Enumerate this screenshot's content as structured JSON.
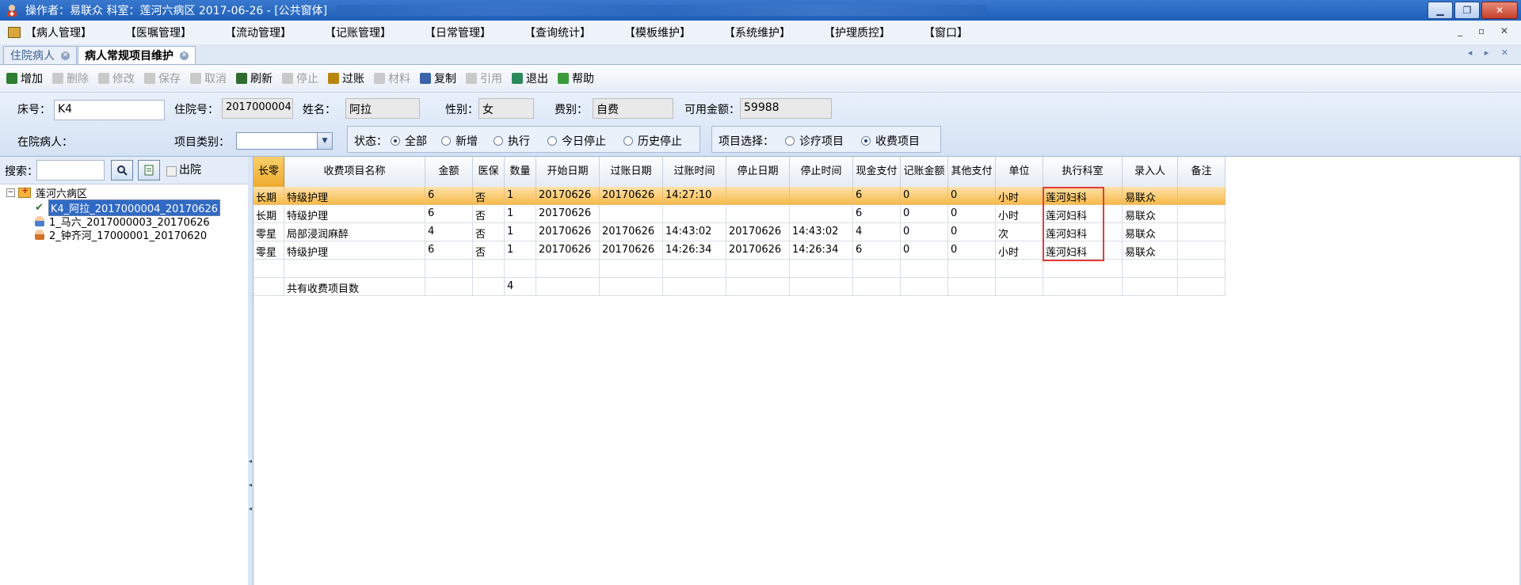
{
  "window": {
    "title": "操作者：易联众  科室：莲河六病区  2017-06-26 - [公共窗体]",
    "controls": {
      "minimize": "▁",
      "restore": "❐",
      "close": "✕"
    }
  },
  "menu": {
    "items": [
      "【病人管理】",
      "【医嘱管理】",
      "【流动管理】",
      "【记账管理】",
      "【日常管理】",
      "【查询统计】",
      "【模板维护】",
      "【系统维护】",
      "【护理质控】",
      "【窗口】"
    ],
    "right_controls": "_ ▫ ✕"
  },
  "tabs": [
    {
      "label": "住院病人",
      "active": false
    },
    {
      "label": "病人常规项目维护",
      "active": true
    }
  ],
  "tab_nav": "◂ ▸ ✕",
  "toolbar": {
    "buttons": [
      {
        "label": "增加",
        "enabled": true,
        "icon": "add-icon",
        "color": "#2e7d32"
      },
      {
        "label": "删除",
        "enabled": false,
        "icon": "delete-icon",
        "color": "#c9c9c9"
      },
      {
        "label": "修改",
        "enabled": false,
        "icon": "edit-icon",
        "color": "#c9c9c9"
      },
      {
        "label": "保存",
        "enabled": false,
        "icon": "save-icon",
        "color": "#c9c9c9"
      },
      {
        "label": "取消",
        "enabled": false,
        "icon": "cancel-icon",
        "color": "#c9c9c9"
      },
      {
        "label": "刷新",
        "enabled": true,
        "icon": "refresh-icon",
        "color": "#2f6b2f"
      },
      {
        "label": "停止",
        "enabled": false,
        "icon": "stop-icon",
        "color": "#c9c9c9"
      },
      {
        "label": "过账",
        "enabled": true,
        "icon": "post-icon",
        "color": "#b8860b"
      },
      {
        "label": "材料",
        "enabled": false,
        "icon": "material-icon",
        "color": "#c9c9c9"
      },
      {
        "label": "复制",
        "enabled": true,
        "icon": "copy-icon",
        "color": "#3b63a8"
      },
      {
        "label": "引用",
        "enabled": false,
        "icon": "reference-icon",
        "color": "#c9c9c9"
      },
      {
        "label": "退出",
        "enabled": true,
        "icon": "exit-icon",
        "color": "#2a8a5a"
      },
      {
        "label": "帮助",
        "enabled": true,
        "icon": "help-icon",
        "color": "#3a9a3a"
      }
    ]
  },
  "patient": {
    "bed_label": "床号：",
    "bed_value": "K4",
    "admission_label": "住院号：",
    "admission_value": "2017000004",
    "name_label": "姓名：",
    "name_value": "阿拉",
    "gender_label": "性别：",
    "gender_value": "女",
    "fee_label": "费别：",
    "fee_value": "自费",
    "balance_label": "可用金额：",
    "balance_value": "59988",
    "inpatient_label": "在院病人：",
    "category_label": "项目类别：",
    "category_value": ""
  },
  "status_filter": {
    "label": "状态：",
    "options": [
      {
        "label": "全部",
        "checked": true
      },
      {
        "label": "新增",
        "checked": false
      },
      {
        "label": "执行",
        "checked": false
      },
      {
        "label": "今日停止",
        "checked": false
      },
      {
        "label": "历史停止",
        "checked": false
      }
    ]
  },
  "item_select": {
    "label": "项目选择：",
    "options": [
      {
        "label": "诊疗项目",
        "checked": false
      },
      {
        "label": "收费项目",
        "checked": true
      }
    ]
  },
  "left_panel": {
    "search_label": "搜索：",
    "search_value": "",
    "discharged_label": "出院",
    "tree": {
      "root": "莲河六病区",
      "patients": [
        {
          "label": "K4_阿拉_2017000004_20170626",
          "selected": true,
          "icon": "checked-patient-icon"
        },
        {
          "label": "1_马六_2017000003_20170626",
          "selected": false,
          "icon": "patient-blue-icon"
        },
        {
          "label": "2_钟齐河_17000001_20170620",
          "selected": false,
          "icon": "patient-orange-icon"
        }
      ]
    }
  },
  "grid": {
    "columns": [
      "长零",
      "收费项目名称",
      "金额",
      "医保",
      "数量",
      "开始日期",
      "过账日期",
      "过账时间",
      "停止日期",
      "停止时间",
      "现金支付",
      "记账金额",
      "其他支付",
      "单位",
      "执行科室",
      "录入人",
      "备注"
    ],
    "rows": [
      [
        "长期",
        "特级护理",
        "6",
        "否",
        "1",
        "20170626",
        "20170626",
        "14:27:10",
        "",
        "",
        "6",
        "0",
        "0",
        "小时",
        "莲河妇科",
        "易联众",
        ""
      ],
      [
        "长期",
        "特级护理",
        "6",
        "否",
        "1",
        "20170626",
        "",
        "",
        "",
        "",
        "6",
        "0",
        "0",
        "小时",
        "莲河妇科",
        "易联众",
        ""
      ],
      [
        "零星",
        "局部浸润麻醉",
        "4",
        "否",
        "1",
        "20170626",
        "20170626",
        "14:43:02",
        "20170626",
        "14:43:02",
        "4",
        "0",
        "0",
        "次",
        "莲河妇科",
        "易联众",
        ""
      ],
      [
        "零星",
        "特级护理",
        "6",
        "否",
        "1",
        "20170626",
        "20170626",
        "14:26:34",
        "20170626",
        "14:26:34",
        "6",
        "0",
        "0",
        "小时",
        "莲河妇科",
        "易联众",
        ""
      ],
      [
        "",
        "",
        "",
        "",
        "",
        "",
        "",
        "",
        "",
        "",
        "",
        "",
        "",
        "",
        "",
        "",
        ""
      ],
      [
        "",
        "共有收费项目数",
        "",
        "",
        "4",
        "",
        "",
        "",
        "",
        "",
        "",
        "",
        "",
        "",
        "",
        "",
        ""
      ]
    ],
    "selected_row": 0,
    "highlight_color": "#e63a3a"
  }
}
